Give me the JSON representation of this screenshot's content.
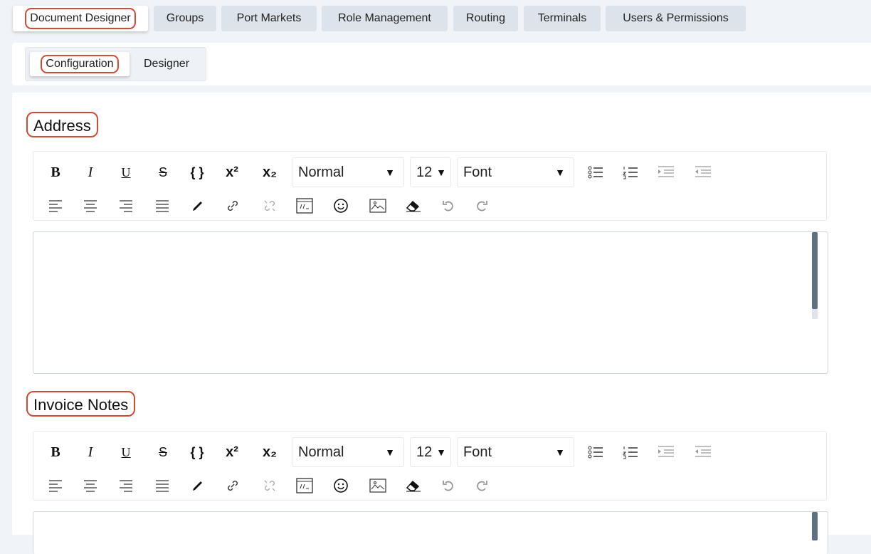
{
  "top_tabs": [
    {
      "label": "Document Designer",
      "active": true
    },
    {
      "label": "Groups",
      "active": false
    },
    {
      "label": "Port Markets",
      "active": false
    },
    {
      "label": "Role Management",
      "active": false
    },
    {
      "label": "Routing",
      "active": false
    },
    {
      "label": "Terminals",
      "active": false
    },
    {
      "label": "Users & Permissions",
      "active": false
    }
  ],
  "sub_tabs": [
    {
      "label": "Configuration",
      "active": true
    },
    {
      "label": "Designer",
      "active": false
    }
  ],
  "editors": [
    {
      "label": "Address",
      "toolbar": {
        "format_select": "Normal",
        "size_select": "12",
        "font_select": "Font"
      },
      "content": ""
    },
    {
      "label": "Invoice Notes",
      "toolbar": {
        "format_select": "Normal",
        "size_select": "12",
        "font_select": "Font"
      },
      "content": ""
    }
  ],
  "toolbar_glyphs": {
    "bold": "B",
    "italic": "I",
    "underline": "U",
    "strike": "S",
    "code": "{ }",
    "superscript": "x²",
    "subscript": "x₂"
  },
  "colors": {
    "highlight": "#d24a35",
    "tab_bg": "#dde3ea",
    "scrollbar": "#5f6f84"
  }
}
